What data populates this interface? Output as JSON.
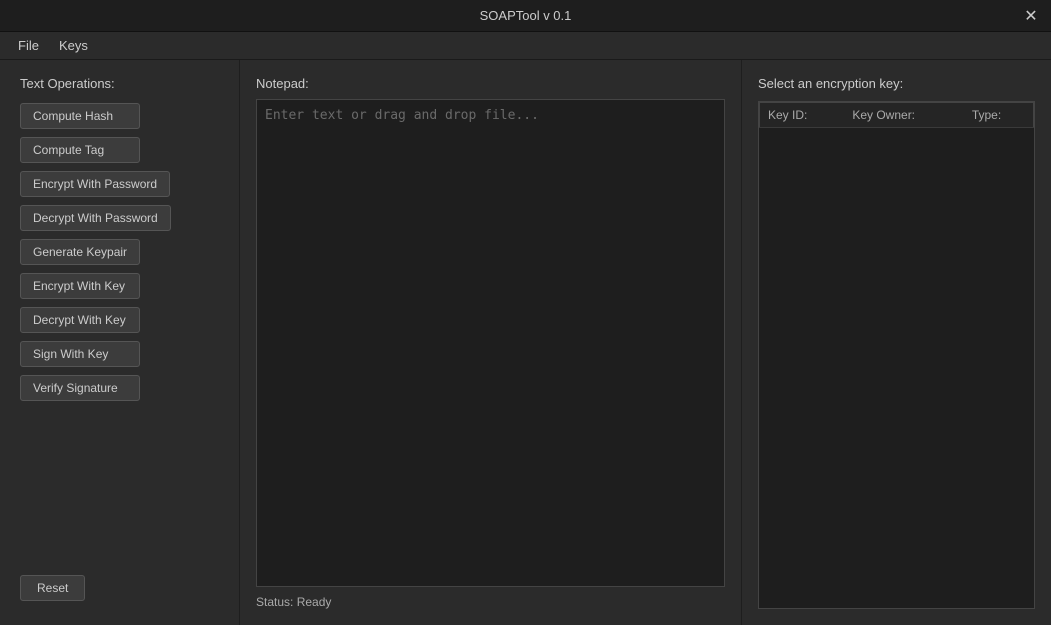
{
  "titleBar": {
    "title": "SOAPTool v 0.1",
    "closeLabel": "✕"
  },
  "menuBar": {
    "items": [
      {
        "id": "file",
        "label": "File"
      },
      {
        "id": "keys",
        "label": "Keys"
      }
    ]
  },
  "leftPanel": {
    "sectionLabel": "Text Operations:",
    "buttons": [
      {
        "id": "compute-hash",
        "label": "Compute Hash"
      },
      {
        "id": "compute-tag",
        "label": "Compute Tag"
      },
      {
        "id": "encrypt-with-password",
        "label": "Encrypt With Password"
      },
      {
        "id": "decrypt-with-password",
        "label": "Decrypt With Password"
      },
      {
        "id": "generate-keypair",
        "label": "Generate Keypair"
      },
      {
        "id": "encrypt-with-key",
        "label": "Encrypt With Key"
      },
      {
        "id": "decrypt-with-key",
        "label": "Decrypt With Key"
      },
      {
        "id": "sign-with-key",
        "label": "Sign With Key"
      },
      {
        "id": "verify-signature",
        "label": "Verify Signature"
      }
    ],
    "resetLabel": "Reset"
  },
  "centerPanel": {
    "notepadLabel": "Notepad:",
    "notepadPlaceholder": "Enter text or drag and drop file...",
    "statusLabel": "Status: Ready"
  },
  "rightPanel": {
    "encryptionLabel": "Select an encryption key:",
    "tableHeaders": [
      {
        "id": "key-id",
        "label": "Key ID:"
      },
      {
        "id": "key-owner",
        "label": "Key Owner:"
      },
      {
        "id": "type",
        "label": "Type:"
      }
    ]
  }
}
